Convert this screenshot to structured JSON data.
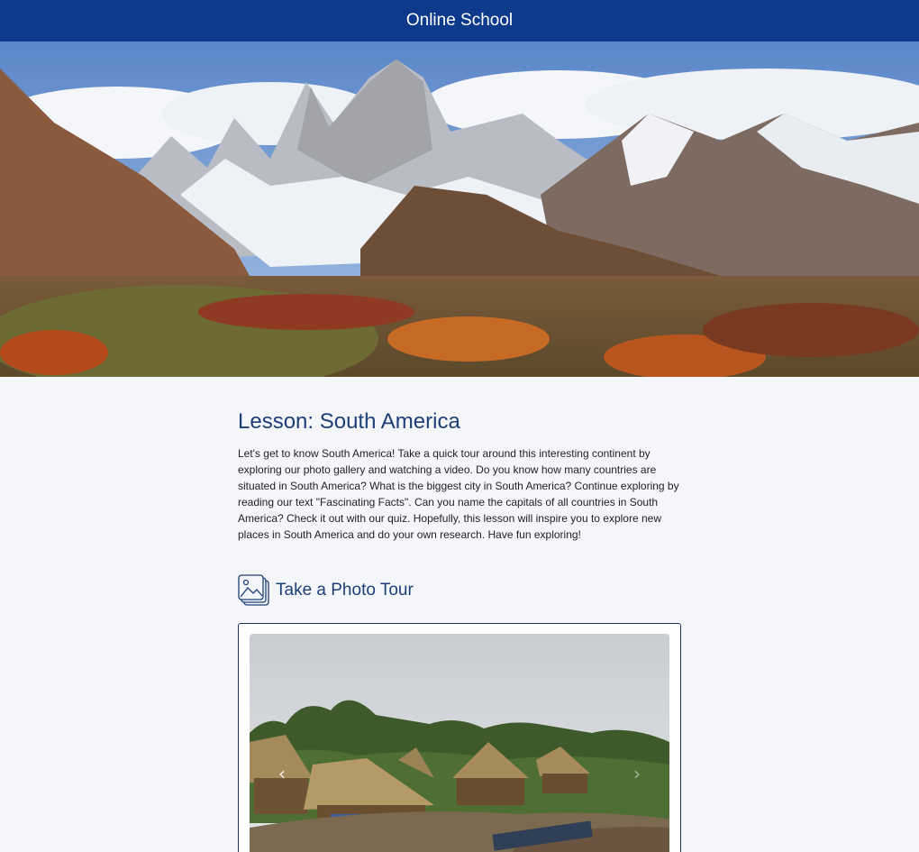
{
  "header": {
    "brand": "Online School"
  },
  "hero": {
    "image": "mountain-landscape-photo"
  },
  "lesson": {
    "title": "Lesson: South America",
    "intro": "Let's get to know South America! Take a quick tour around this interesting continent by exploring our photo gallery and watching a video. Do you know how many countries are situated in South America? What is the biggest city in South America? Continue exploring by reading our text \"Fascinating Facts\". Can you name the capitals of all countries in South America? Check it out with our quiz. Hopefully, this lesson will inspire you to explore new places in South America and do your own research. Have fun exploring!"
  },
  "photo_tour": {
    "title": "Take a Photo Tour",
    "icon": "photo-gallery-icon",
    "slide_image": "amazon-village-photo",
    "prev_icon": "chevron-left-icon",
    "next_icon": "chevron-right-icon"
  },
  "colors": {
    "header_bg": "#0d3a8a",
    "accent": "#1d3f77",
    "page_bg": "#f5f6fa"
  }
}
